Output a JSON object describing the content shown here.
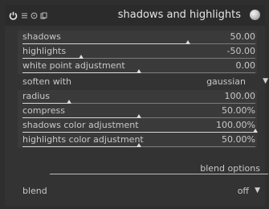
{
  "module": {
    "title": "shadows and highlights",
    "header_icons": [
      "power-icon",
      "presets-icon",
      "reset-icon",
      "instances-icon"
    ]
  },
  "params": [
    {
      "label": "shadows",
      "value": "50.00",
      "level": 0.71
    },
    {
      "label": "highlights",
      "value": "-50.00",
      "level": 0.25
    },
    {
      "label": "white point adjustment",
      "value": "0.00",
      "level": 0.5
    },
    {
      "label": "soften with",
      "value": "gaussian",
      "type": "combo"
    },
    {
      "label": "radius",
      "value": "100.00",
      "level": 0.2
    },
    {
      "label": "compress",
      "value": "50.00%",
      "level": 0.5
    },
    {
      "label": "shadows color adjustment",
      "value": "100.00%",
      "level": 1.0
    },
    {
      "label": "highlights color adjustment",
      "value": "50.00%",
      "level": 0.5
    }
  ],
  "blend_options_label": "blend options",
  "blend": {
    "label": "blend",
    "value": "off"
  },
  "colors": {
    "background": "#2e2e2e",
    "panel": "#333333",
    "text": "#c8c8c8"
  }
}
